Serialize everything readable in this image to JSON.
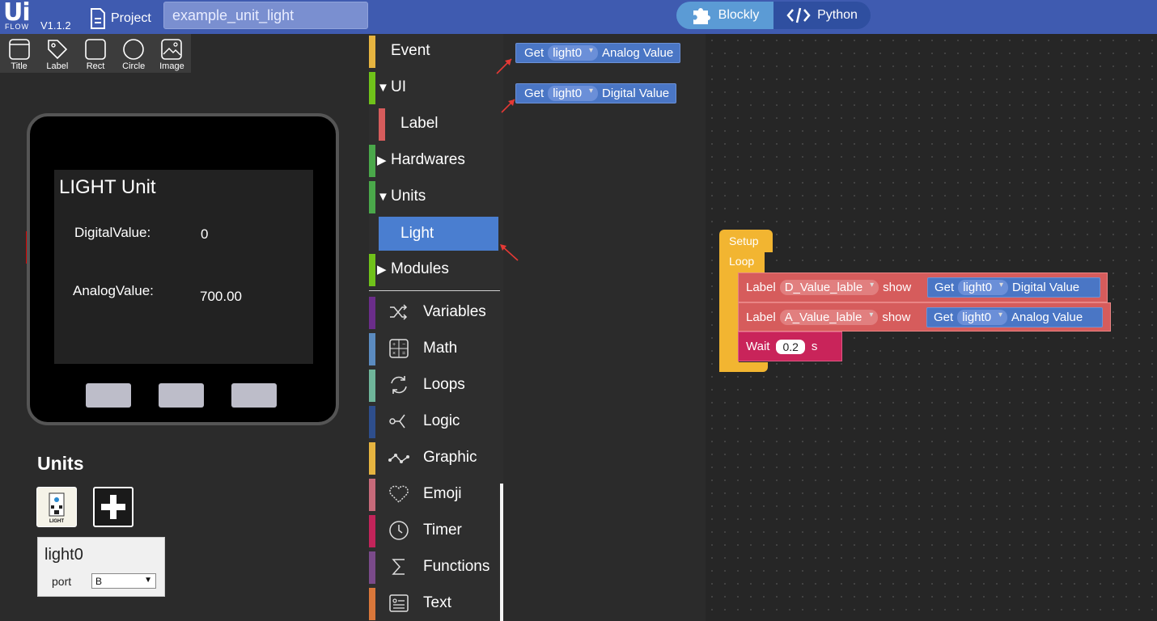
{
  "header": {
    "logo_top": "Ui",
    "logo_bottom": "FLOW",
    "version": "V1.1.2",
    "project_label": "Project",
    "project_name": "example_unit_light",
    "mode_blockly": "Blockly",
    "mode_python": "Python"
  },
  "tools": [
    {
      "label": "Title",
      "icon": "title-icon"
    },
    {
      "label": "Label",
      "icon": "label-tag-icon"
    },
    {
      "label": "Rect",
      "icon": "rect-icon"
    },
    {
      "label": "Circle",
      "icon": "circle-icon"
    },
    {
      "label": "Image",
      "icon": "image-icon"
    }
  ],
  "screen": {
    "title": "LIGHT Unit",
    "digital_label": "DigitalValue:",
    "digital_value": "0",
    "analog_label": "AnalogValue:",
    "analog_value": "700.00"
  },
  "units": {
    "heading": "Units",
    "light_icon_caption": "LIGHT",
    "card_name": "light0",
    "port_label": "port",
    "port_value": "B"
  },
  "toolbox": {
    "event": "Event",
    "ui": "UI",
    "label": "Label",
    "hardwares": "Hardwares",
    "units": "Units",
    "light": "Light",
    "modules": "Modules",
    "variables": "Variables",
    "math": "Math",
    "loops": "Loops",
    "logic": "Logic",
    "graphic": "Graphic",
    "emoji": "Emoji",
    "timer": "Timer",
    "functions": "Functions",
    "text": "Text"
  },
  "colors": {
    "header": "#3f5bb0",
    "event": "#e6b440",
    "ui": "#70c21a",
    "label_cat": "#d65c5c",
    "hardwares": "#4aa84a",
    "units": "#4aa84a",
    "modules": "#70c21a",
    "variables": "#6b2d8a",
    "math": "#5b8bc0",
    "loops": "#6fb59a",
    "logic": "#2e4e8c",
    "graphic": "#e6b440",
    "emoji": "#c76a7a",
    "timer": "#c2245a",
    "functions": "#7a4a8a",
    "text": "#d9773a"
  },
  "flyout": {
    "get_analog": {
      "get": "Get",
      "unit": "light0",
      "value": "Analog Value"
    },
    "get_digital": {
      "get": "Get",
      "unit": "light0",
      "value": "Digital Value"
    }
  },
  "workspace": {
    "setup": "Setup",
    "loop": "Loop",
    "row1": {
      "label": "Label",
      "target": "D_Value_lable",
      "show": "show",
      "get": "Get",
      "unit": "light0",
      "value": "Digital Value"
    },
    "row2": {
      "label": "Label",
      "target": "A_Value_lable",
      "show": "show",
      "get": "Get",
      "unit": "light0",
      "value": "Analog Value"
    },
    "wait": {
      "label": "Wait",
      "value": "0.2",
      "unit": "s"
    }
  }
}
